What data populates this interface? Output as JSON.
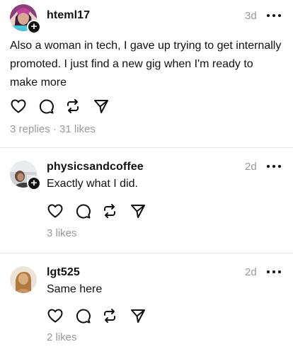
{
  "posts": [
    {
      "username": "hteml17",
      "time": "3d",
      "text": "Also a woman in tech, I gave up trying to get internally promoted. I just find a new gig when I'm ready to make more",
      "meta": "3 replies · 31 likes"
    },
    {
      "username": "physicsandcoffee",
      "time": "2d",
      "text": "Exactly what I did.",
      "meta": "3 likes"
    },
    {
      "username": "lgt525",
      "time": "2d",
      "text": "Same here",
      "meta": "2 likes"
    }
  ],
  "icons": {
    "like": "heart-icon",
    "reply": "comment-bubble-icon",
    "repost": "repost-icon",
    "share": "send-icon",
    "more": "more-horizontal-icon",
    "follow": "plus-icon"
  },
  "colors": {
    "text": "#101010",
    "secondary": "#999999",
    "divider": "#e4e4e4"
  }
}
